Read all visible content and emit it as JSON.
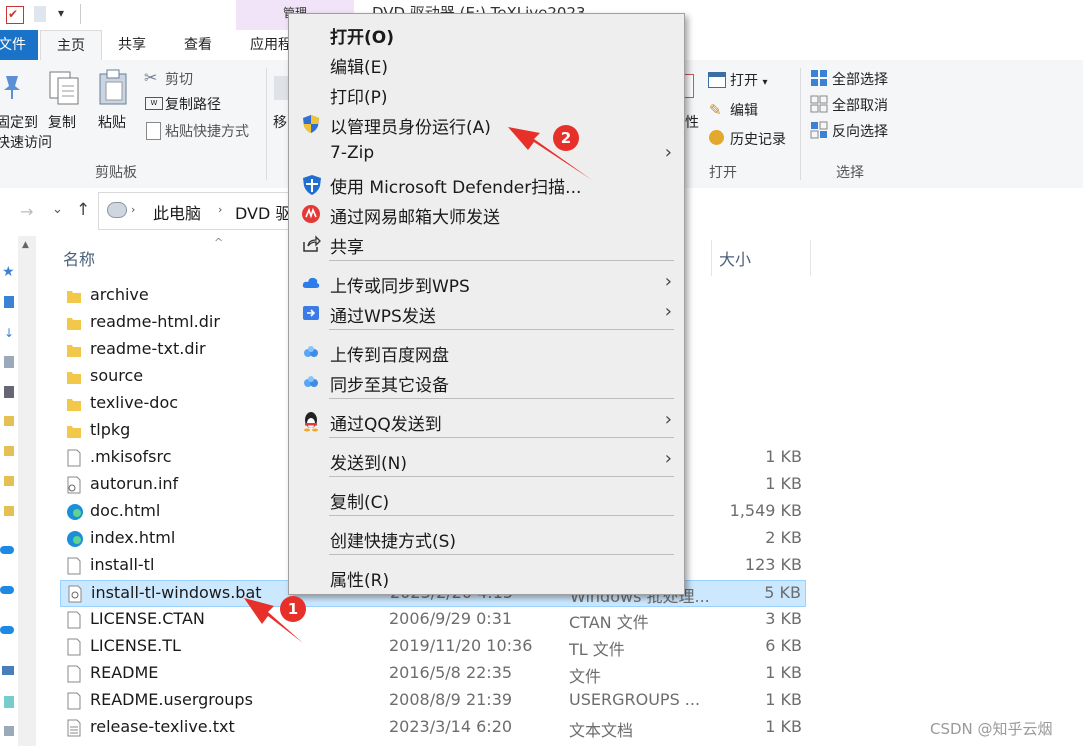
{
  "window": {
    "manage_tab": "管理",
    "title": "DVD 驱动器 (E:) TeXLive2023"
  },
  "ribbon_tabs": {
    "file": "文件",
    "home": "主页",
    "share": "共享",
    "view": "查看",
    "app": "应用程序工具"
  },
  "ribbon": {
    "pin_label_1": "固定到",
    "pin_label_2": "快速访问",
    "copy": "复制",
    "paste": "粘贴",
    "cut": "剪切",
    "copy_path": "复制路径",
    "paste_shortcut": "粘贴快捷方式",
    "group_clipboard": "剪贴板",
    "move": "移",
    "open_dropdown": "打开",
    "edit": "编辑",
    "history": "历史记录",
    "properties_partial": "性",
    "group_open": "打开",
    "select_all": "全部选择",
    "select_none": "全部取消",
    "invert_select": "反向选择",
    "group_select": "选择"
  },
  "address": {
    "pc": "此电脑",
    "drive": "DVD 驱动器"
  },
  "file_list": {
    "col_name": "名称",
    "col_size": "大小",
    "files": [
      {
        "name": "archive",
        "date": "",
        "type": "",
        "size": "",
        "icon": "folder-icon"
      },
      {
        "name": "readme-html.dir",
        "date": "",
        "type": "",
        "size": "",
        "icon": "folder-icon"
      },
      {
        "name": "readme-txt.dir",
        "date": "",
        "type": "",
        "size": "",
        "icon": "folder-icon"
      },
      {
        "name": "source",
        "date": "",
        "type": "",
        "size": "",
        "icon": "folder-icon"
      },
      {
        "name": "texlive-doc",
        "date": "",
        "type": "",
        "size": "",
        "icon": "folder-icon"
      },
      {
        "name": "tlpkg",
        "date": "",
        "type": "",
        "size": "",
        "icon": "folder-icon"
      },
      {
        "name": ".mkisofsrc",
        "date": "",
        "type": "...",
        "size": "1 KB",
        "icon": "file-icon"
      },
      {
        "name": "autorun.inf",
        "date": "",
        "type": "",
        "size": "1 KB",
        "icon": "settings-file-icon"
      },
      {
        "name": "doc.html",
        "date": "",
        "type": "...",
        "size": "1,549 KB",
        "icon": "edge-icon"
      },
      {
        "name": "index.html",
        "date": "",
        "type": "...",
        "size": "2 KB",
        "icon": "edge-icon"
      },
      {
        "name": "install-tl",
        "date": "",
        "type": "",
        "size": "123 KB",
        "icon": "file-icon"
      },
      {
        "name": "install-tl-windows.bat",
        "date": "2023/2/20 4:15",
        "type": "Windows 批处理...",
        "size": "5 KB",
        "icon": "bat-icon"
      },
      {
        "name": "LICENSE.CTAN",
        "date": "2006/9/29 0:31",
        "type": "CTAN 文件",
        "size": "3 KB",
        "icon": "file-icon"
      },
      {
        "name": "LICENSE.TL",
        "date": "2019/11/20 10:36",
        "type": "TL 文件",
        "size": "6 KB",
        "icon": "file-icon"
      },
      {
        "name": "README",
        "date": "2016/5/8 22:35",
        "type": "文件",
        "size": "1 KB",
        "icon": "file-icon"
      },
      {
        "name": "README.usergroups",
        "date": "2008/8/9 21:39",
        "type": "USERGROUPS ...",
        "size": "1 KB",
        "icon": "file-icon"
      },
      {
        "name": "release-texlive.txt",
        "date": "2023/3/14 6:20",
        "type": "文本文档",
        "size": "1 KB",
        "icon": "text-file-icon"
      }
    ]
  },
  "context_menu": {
    "open": "打开(O)",
    "edit": "编辑(E)",
    "print": "打印(P)",
    "run_as_admin": "以管理员身份运行(A)",
    "seven_zip": "7-Zip",
    "defender": "使用 Microsoft Defender扫描...",
    "netease": "通过网易邮箱大师发送",
    "share": "共享",
    "wps_upload": "上传或同步到WPS",
    "wps_send": "通过WPS发送",
    "baidu_upload": "上传到百度网盘",
    "sync_devices": "同步至其它设备",
    "qq_send": "通过QQ发送到",
    "send_to": "发送到(N)",
    "copy": "复制(C)",
    "create_shortcut": "创建快捷方式(S)",
    "properties": "属性(R)"
  },
  "annotations": {
    "badge_1": "1",
    "badge_2": "2",
    "accent": "#e8302a"
  },
  "watermark": "CSDN @知乎云烟"
}
